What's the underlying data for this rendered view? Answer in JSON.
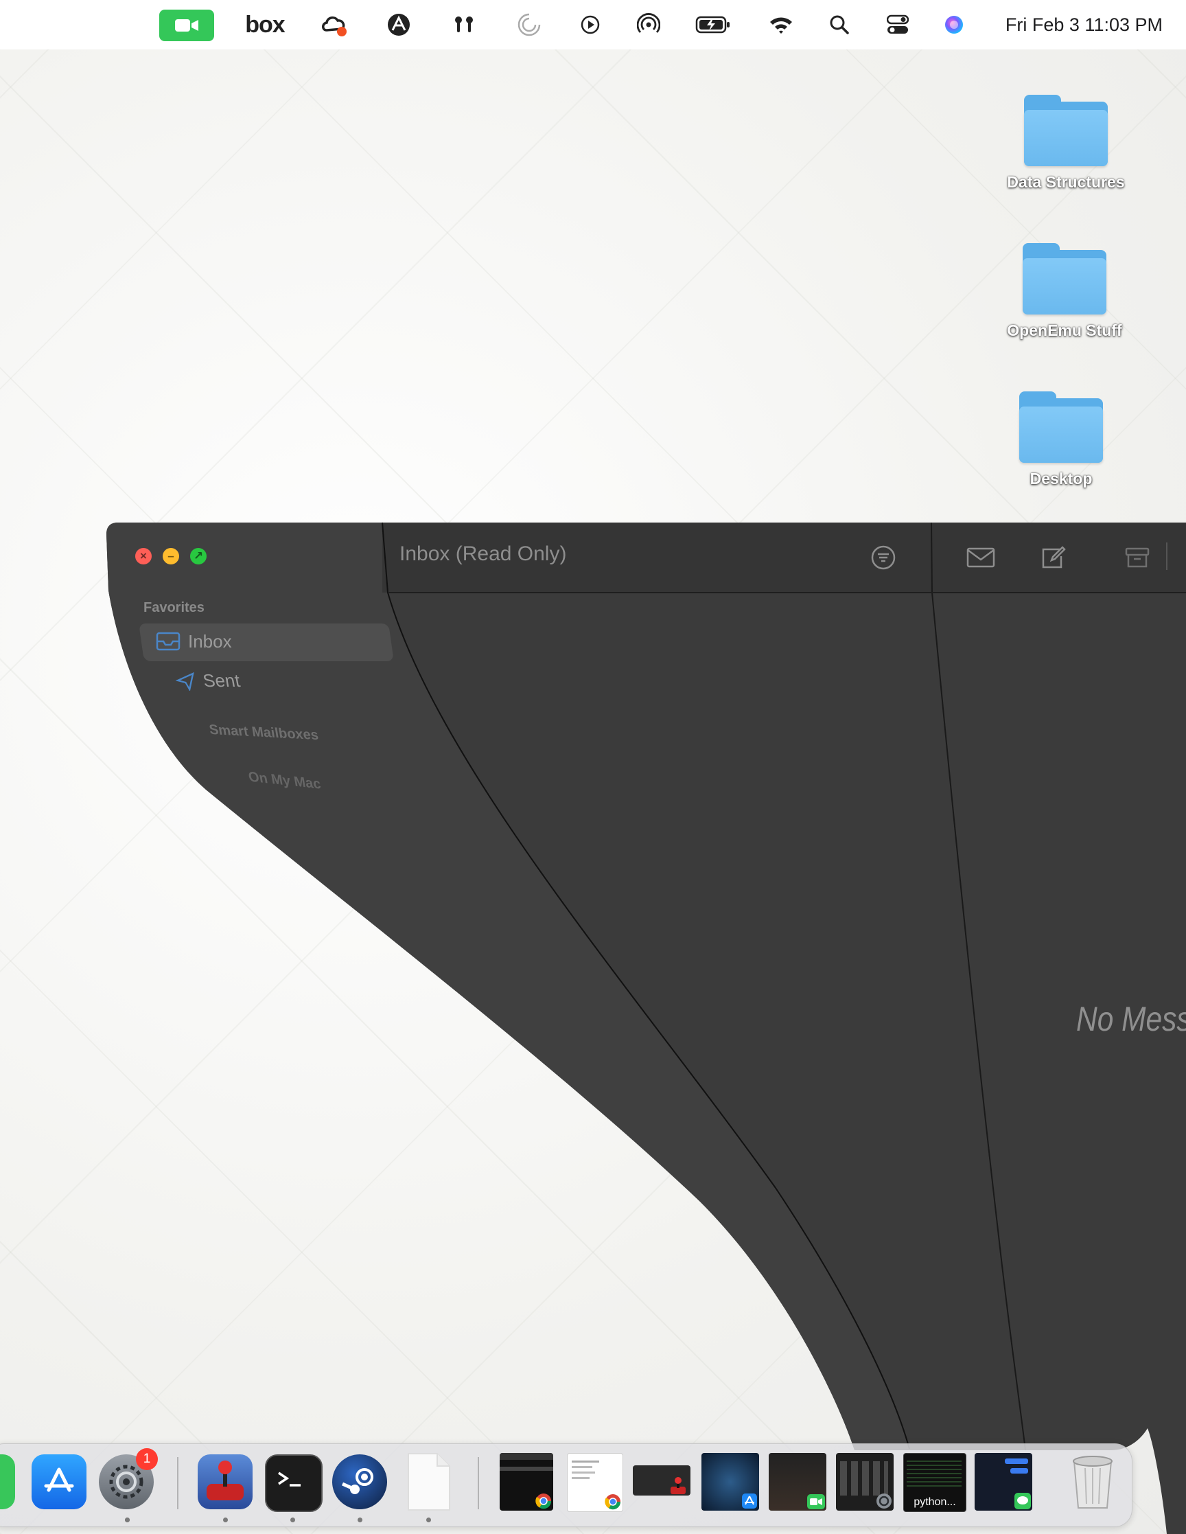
{
  "menubar": {
    "clock": "Fri Feb 3  11:03 PM",
    "brand_text": "box",
    "icons": [
      "facetime-icon",
      "box-icon",
      "creative-cloud-icon",
      "vpn-icon",
      "airpods-icon",
      "loading-icon",
      "play-icon",
      "airplay-icon",
      "battery-icon",
      "wifi-icon",
      "spotlight-icon",
      "control-center-icon",
      "siri-icon"
    ]
  },
  "desktop": {
    "items": [
      {
        "label": "Data Structures"
      },
      {
        "label": "OpenEmu Stuff"
      },
      {
        "label": "Desktop"
      }
    ]
  },
  "mail": {
    "title": "Inbox (Read Only)",
    "sidebar": {
      "favorites_header": "Favorites",
      "inbox_label": "Inbox",
      "sent_label": "Sent",
      "smart_mailboxes": "Smart Mailboxes",
      "on_my_mac": "On My Mac"
    },
    "empty_state": "No Messag"
  },
  "dock": {
    "badge": "1",
    "window_label": "python...",
    "colors": {
      "appstore": "#1e88f5",
      "terminal": "#1c1c1c",
      "steam": "#1b2a4a",
      "joystick": "#d62b2b"
    }
  },
  "colors": {
    "window_bg": "#383838",
    "window_bg_light": "#3f3f3f",
    "close": "#ff5f57",
    "minimize": "#febc2e",
    "zoom": "#28c840",
    "facetime": "#34c759"
  }
}
